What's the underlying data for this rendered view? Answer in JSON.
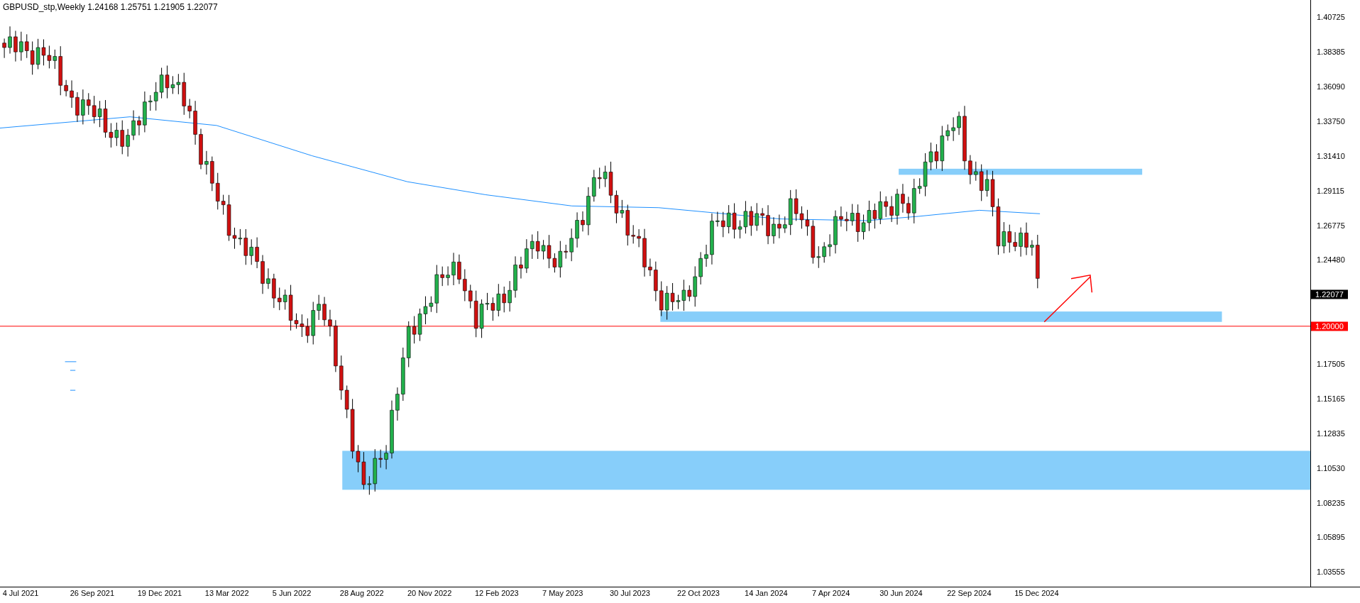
{
  "chart": {
    "symbol": "GBPUSD_stp,Weekly",
    "quotes": [
      "1.24168",
      "1.25751",
      "1.21905",
      "1.22077"
    ]
  },
  "price_axis": {
    "labels": [
      "1.40725",
      "1.38385",
      "1.36090",
      "1.33750",
      "1.31410",
      "1.29115",
      "1.26775",
      "1.24480",
      "1.17505",
      "1.15165",
      "1.12835",
      "1.10530",
      "1.08235",
      "1.05895",
      "1.03555"
    ],
    "current_price": "1.22077",
    "level_price": "1.20000"
  },
  "time_axis": {
    "labels": [
      "4 Jul 2021",
      "26 Sep 2021",
      "19 Dec 2021",
      "13 Mar 2022",
      "5 Jun 2022",
      "28 Aug 2022",
      "20 Nov 2022",
      "12 Feb 2023",
      "7 May 2023",
      "30 Jul 2023",
      "22 Oct 2023",
      "14 Jan 2024",
      "7 Apr 2024",
      "30 Jun 2024",
      "22 Sep 2024",
      "15 Dec 2024"
    ]
  }
}
